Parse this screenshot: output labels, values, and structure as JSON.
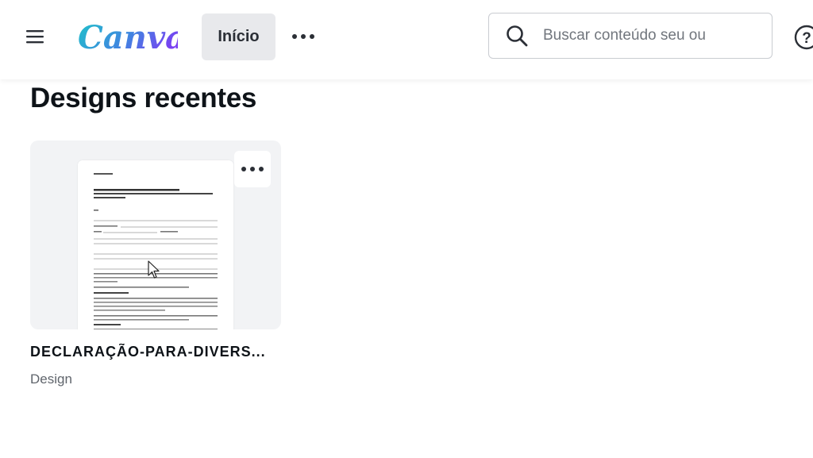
{
  "header": {
    "logo_text": "Canva",
    "nav_home_label": "Início",
    "search": {
      "placeholder": "Buscar conteúdo seu ou",
      "value": ""
    },
    "help_symbol": "?"
  },
  "main": {
    "section_title": "Designs recentes",
    "designs": [
      {
        "name": "DECLARAÇÃO-PARA-DIVERS...",
        "type": "Design"
      }
    ]
  },
  "colors": {
    "logo_gradient_start": "#1fc3c9",
    "logo_gradient_end": "#7a3ff2",
    "nav_active_bg": "#e8e9ec",
    "card_bg": "#f2f3f5"
  },
  "icons": {
    "menu": "hamburger-menu-icon",
    "more": "more-horizontal-icon",
    "search": "search-icon",
    "help": "help-circle-icon",
    "cursor": "mouse-pointer-icon"
  }
}
